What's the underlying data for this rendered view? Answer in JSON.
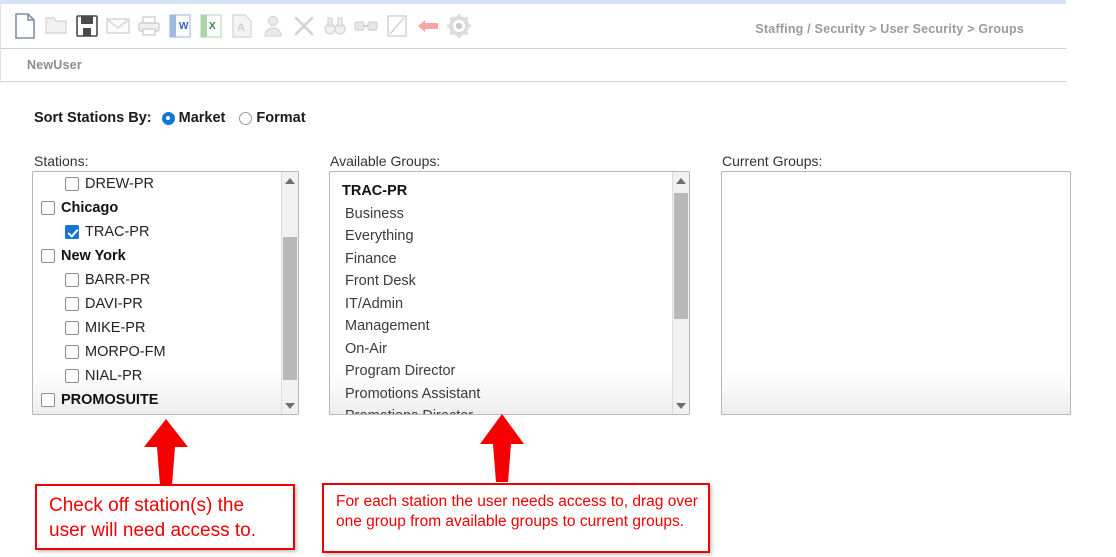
{
  "header": {
    "breadcrumb": "Staffing / Security > User Security > Groups",
    "toolbar_icons": [
      {
        "name": "new-document-icon",
        "title": "New"
      },
      {
        "name": "open-folder-icon",
        "title": "Open"
      },
      {
        "name": "save-floppy-icon",
        "title": "Save"
      },
      {
        "name": "email-envelope-icon",
        "title": "Email"
      },
      {
        "name": "print-icon",
        "title": "Print"
      },
      {
        "name": "export-word-icon",
        "title": "Export to Word"
      },
      {
        "name": "export-excel-icon",
        "title": "Export to Excel"
      },
      {
        "name": "export-pdf-icon",
        "title": "Export to PDF"
      },
      {
        "name": "user-icon",
        "title": "User"
      },
      {
        "name": "delete-x-icon",
        "title": "Delete"
      },
      {
        "name": "binoculars-icon",
        "title": "Find"
      },
      {
        "name": "link-icon",
        "title": "Link"
      },
      {
        "name": "edit-note-icon",
        "title": "Edit"
      },
      {
        "name": "back-arrow-icon",
        "title": "Back"
      },
      {
        "name": "settings-gear-icon",
        "title": "Settings"
      }
    ]
  },
  "tabs": {
    "active_tab": "NewUser"
  },
  "sort": {
    "label": "Sort Stations By:",
    "options": [
      {
        "label": "Market",
        "selected": true
      },
      {
        "label": "Format",
        "selected": false
      }
    ]
  },
  "stations": {
    "label": "Stations:",
    "items": [
      {
        "label": "DREW-PR",
        "level": "child",
        "checked": false
      },
      {
        "label": "Chicago",
        "level": "group",
        "checked": false
      },
      {
        "label": "TRAC-PR",
        "level": "child",
        "checked": true
      },
      {
        "label": "New York",
        "level": "group",
        "checked": false
      },
      {
        "label": "BARR-PR",
        "level": "child",
        "checked": false
      },
      {
        "label": "DAVI-PR",
        "level": "child",
        "checked": false
      },
      {
        "label": "MIKE-PR",
        "level": "child",
        "checked": false
      },
      {
        "label": "MORPO-FM",
        "level": "child",
        "checked": false
      },
      {
        "label": "NIAL-PR",
        "level": "child",
        "checked": false
      },
      {
        "label": "PROMOSUITE",
        "level": "group",
        "checked": false
      }
    ],
    "scrollbar": {
      "thumb_top_pct": 23,
      "thumb_height_pct": 68
    }
  },
  "available_groups": {
    "label": "Available Groups:",
    "items": [
      {
        "label": "TRAC-PR",
        "type": "header"
      },
      {
        "label": "Business",
        "type": "item"
      },
      {
        "label": "Everything",
        "type": "item"
      },
      {
        "label": "Finance",
        "type": "item"
      },
      {
        "label": "Front Desk",
        "type": "item"
      },
      {
        "label": "IT/Admin",
        "type": "item"
      },
      {
        "label": "Management",
        "type": "item"
      },
      {
        "label": "On-Air",
        "type": "item"
      },
      {
        "label": "Program Director",
        "type": "item"
      },
      {
        "label": "Promotions Assistant",
        "type": "item"
      },
      {
        "label": "Promotions Director",
        "type": "item"
      }
    ],
    "scrollbar": {
      "thumb_top_pct": 2,
      "thumb_height_pct": 60
    }
  },
  "current_groups": {
    "label": "Current Groups:",
    "items": []
  },
  "annotations": [
    {
      "name": "stations-callout",
      "text": "Check off station(s) the user will need access to."
    },
    {
      "name": "groups-callout",
      "text": "For each station the user needs access to, drag over one group from available groups to current groups."
    }
  ],
  "colors": {
    "accent_blue": "#1675d1",
    "annotation_red": "#ee0000",
    "breadcrumb_gray": "#9b9b9b"
  }
}
